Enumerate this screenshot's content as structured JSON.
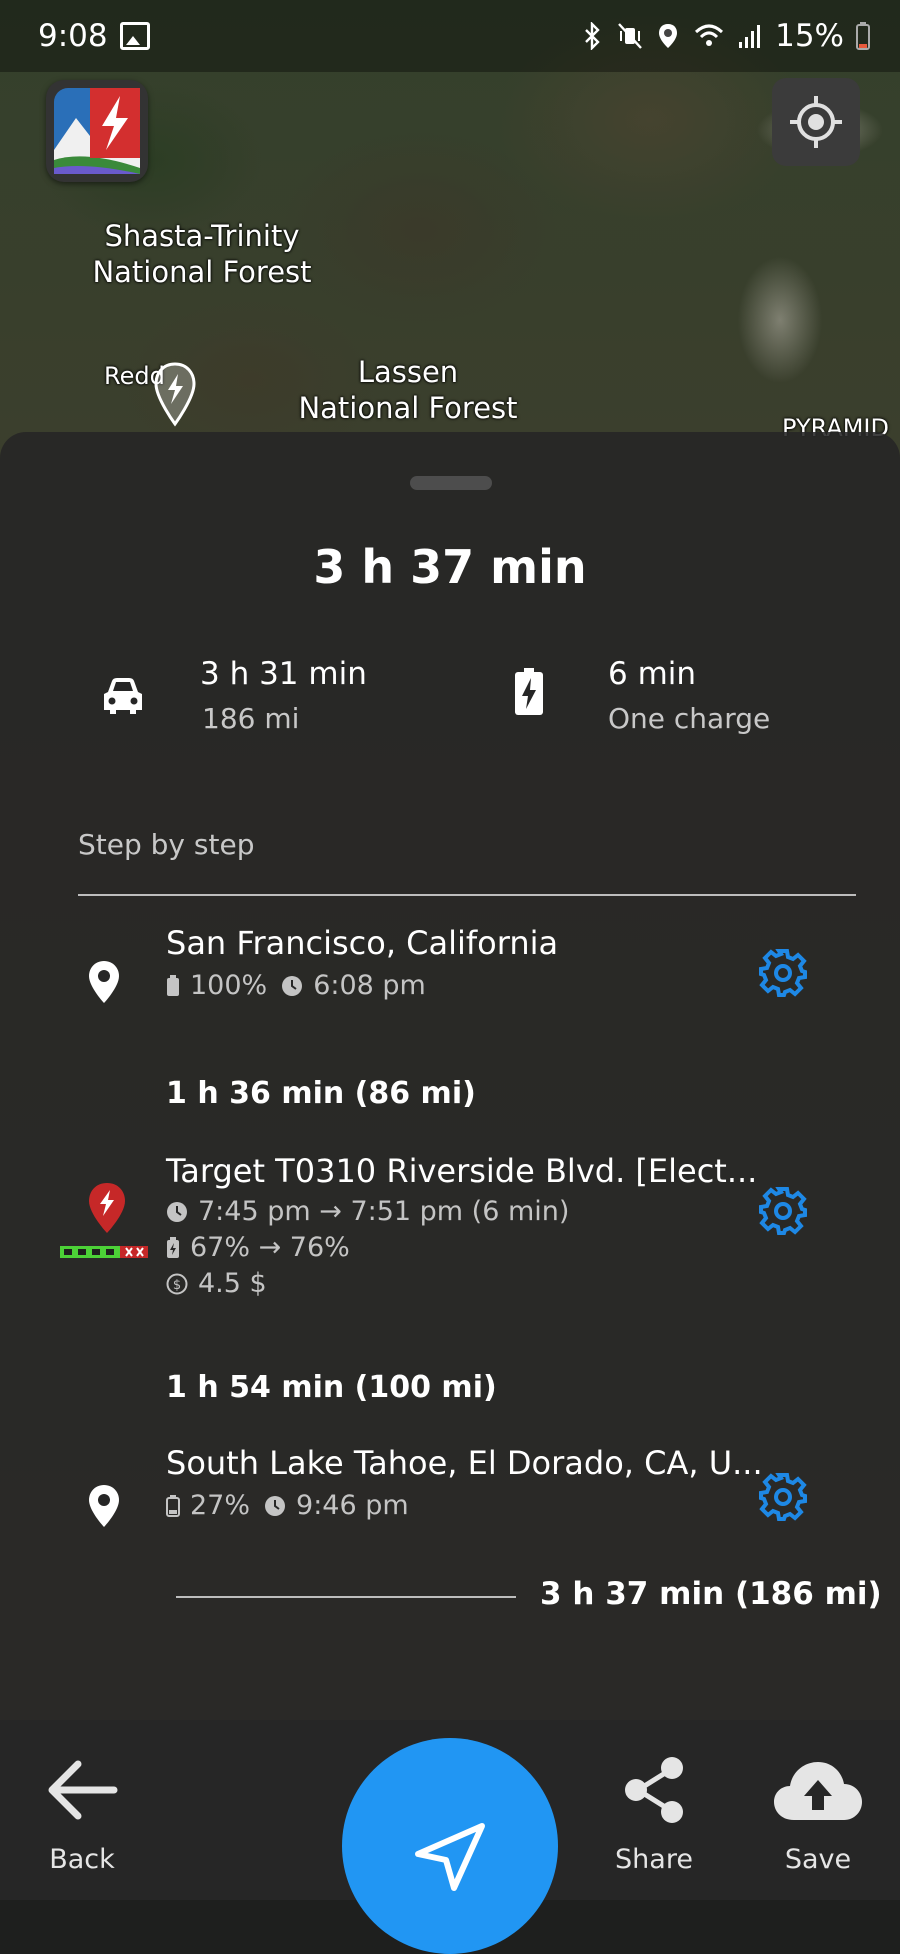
{
  "status_bar": {
    "time": "9:08",
    "battery": "15%"
  },
  "map": {
    "labels": {
      "shasta": "Shasta-Trinity\nNational Forest",
      "redding": "Redd",
      "lassen": "Lassen\nNational Forest",
      "pyramid": "PYRAMID"
    }
  },
  "route": {
    "total_time": "3 h 37 min",
    "drive_time": "3 h 31 min",
    "distance": "186 mi",
    "charge_time": "6 min",
    "charge_count": "One charge",
    "step_by_step_label": "Step by step",
    "stops": [
      {
        "name": "San Francisco, California",
        "battery": "100%",
        "time": "6:08 pm"
      },
      {
        "name": "Target T0310 Riverside Blvd. [Elect...",
        "time_range": "7:45 pm → 7:51 pm (6 min)",
        "battery_range": "67% → 76%",
        "cost": "4.5 $"
      },
      {
        "name": "South Lake Tahoe, El Dorado, CA, U...",
        "battery": "27%",
        "time": "9:46 pm"
      }
    ],
    "legs": [
      "1 h 36 min (86 mi)",
      "1 h 54 min (100 mi)"
    ],
    "total_summary": "3 h 37 min (186 mi)"
  },
  "bottom_nav": {
    "back": "Back",
    "share": "Share",
    "save": "Save"
  },
  "colors": {
    "accent": "#2196f3",
    "sheet": "#262626",
    "pin_red": "#c62828"
  }
}
